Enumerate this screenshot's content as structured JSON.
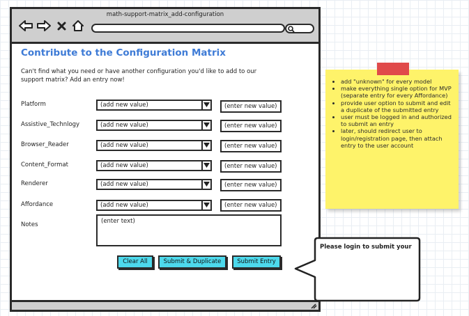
{
  "window": {
    "title": "math-support-matrix_add-configuration"
  },
  "page": {
    "title": "Contribute to the Configuration Matrix",
    "intro": "Can't find what you need or have another configuration you'd like to add to our support matrix? Add an entry now!"
  },
  "fields": [
    {
      "label": "Platform",
      "select_value": "(add new value)",
      "input_value": "(enter new value)"
    },
    {
      "label": "Assistive_Technlogy",
      "select_value": "(add new value)",
      "input_value": "(enter new value)"
    },
    {
      "label": "Browser_Reader",
      "select_value": "(add new value)",
      "input_value": "(enter new value)"
    },
    {
      "label": "Content_Format",
      "select_value": "(add new value)",
      "input_value": "(enter new value)"
    },
    {
      "label": "Renderer",
      "select_value": "(add new value)",
      "input_value": "(enter new value)"
    },
    {
      "label": "Affordance",
      "select_value": "(add new value)",
      "input_value": "(enter new value)"
    }
  ],
  "notes": {
    "label": "Notes",
    "placeholder": "(enter text)"
  },
  "buttons": {
    "clear_all": "Clear All",
    "submit_duplicate": "Submit & Duplicate",
    "submit_entry": "Submit Entry"
  },
  "sticky_note": {
    "items": [
      "add \"unknown\" for every model",
      "make everything single option for MVP (separate entry for every Affordance)",
      "provide user option to submit and edit a duplicate of the submitted entry",
      "user must be logged in and authorized to submit an entry",
      "later, should redirect user to login/registration page, then attach entry to the user account"
    ]
  },
  "callout": {
    "text": "Please login to submit your"
  },
  "colors": {
    "title_blue": "#3e7bd6",
    "button_cyan": "#4dd9ec",
    "sticky_yellow": "#fef36a",
    "tape_red": "#e04a4a"
  },
  "icons": [
    "back-arrow-icon",
    "forward-arrow-icon",
    "close-x-icon",
    "home-icon",
    "search-icon",
    "dropdown-arrow-icon",
    "resize-grip-icon"
  ]
}
